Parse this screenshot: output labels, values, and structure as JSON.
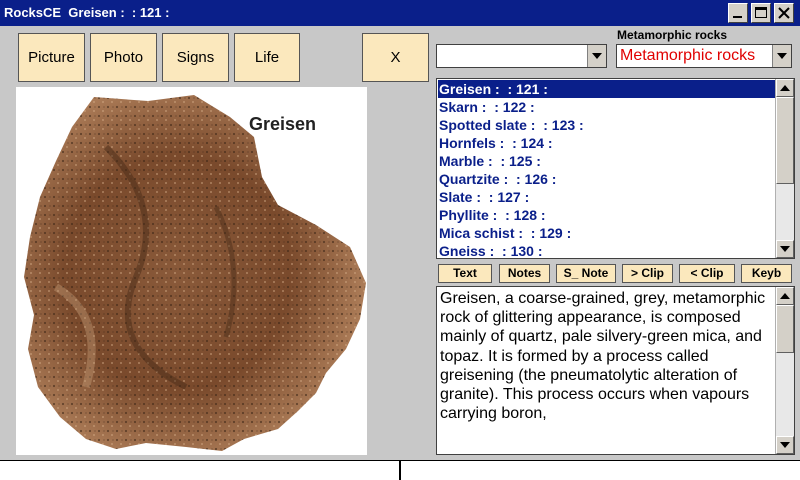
{
  "titlebar": {
    "title": "RocksCE  Greisen :  : 121 :",
    "buttons": [
      "minimize-icon",
      "maximize-icon",
      "close-icon"
    ]
  },
  "toolbar": {
    "picture_label": "Picture",
    "photo_label": "Photo",
    "signs_label": "Signs",
    "life_label": "Life",
    "close_label": "X"
  },
  "image": {
    "caption": "Greisen"
  },
  "category": {
    "label": "Metamorphic rocks",
    "left_combo_value": "",
    "selected": "Metamorphic rocks",
    "color": "#e00000"
  },
  "rock_list": {
    "items": [
      "Greisen :  : 121 :",
      "Skarn :  : 122 :",
      "Spotted slate :  : 123 :",
      "Hornfels :  : 124 :",
      "Marble :  : 125 :",
      "Quartzite :  : 126 :",
      "Slate :  : 127 :",
      "Phyllite :  : 128 :",
      "Mica schist :  : 129 :",
      "Gneiss :  : 130 :"
    ],
    "selected_index": 0
  },
  "action_buttons": {
    "text": "Text",
    "notes": "Notes",
    "s_note": "S_ Note",
    "clip_next": "> Clip",
    "clip_prev": "< Clip",
    "keyb": "Keyb"
  },
  "description": {
    "text": "Greisen, a coarse-grained, grey, metamorphic rock of glittering appearance, is composed mainly of quartz, pale silvery-green mica, and topaz. It is formed by a process called greisening (the pneumatolytic alteration of granite). This process occurs when vapours carrying boron,"
  },
  "colors": {
    "titlebar": "#0a1f8a",
    "window_bg": "#c8c8c8",
    "button_bg": "#fbe8bd",
    "list_text": "#0a1f8a"
  }
}
